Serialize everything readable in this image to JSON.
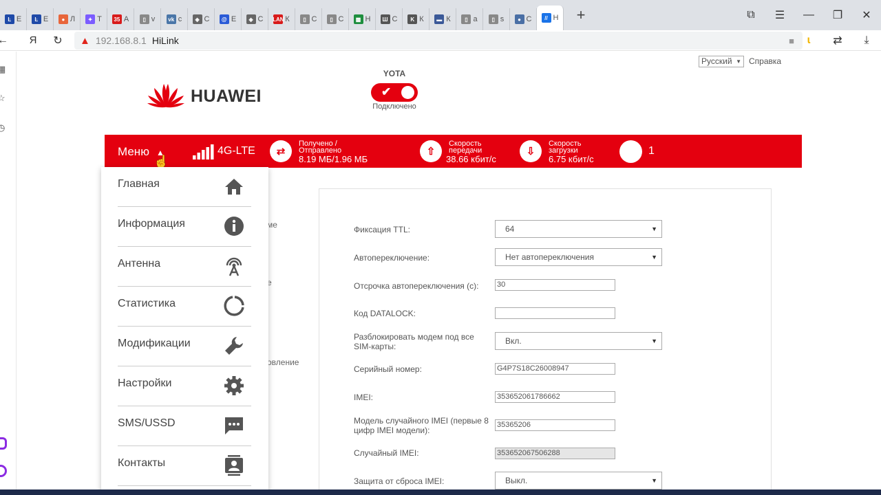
{
  "browser": {
    "tabs": [
      {
        "letter": "Ŀ",
        "color": "#1f4aa8",
        "label": "Е"
      },
      {
        "letter": "Ŀ",
        "color": "#1f4aa8",
        "label": "Е"
      },
      {
        "letter": "●",
        "color": "#e8663b",
        "label": "Л"
      },
      {
        "letter": "✦",
        "color": "#7b5cff",
        "label": "T"
      },
      {
        "letter": "35",
        "color": "#d81b1b",
        "label": "А"
      },
      {
        "letter": "▯",
        "color": "#888888",
        "label": "v"
      },
      {
        "letter": "vk",
        "color": "#4a76a8",
        "label": "c"
      },
      {
        "letter": "◈",
        "color": "#666666",
        "label": "С"
      },
      {
        "letter": "@",
        "color": "#2a5bd7",
        "label": "E"
      },
      {
        "letter": "◈",
        "color": "#666666",
        "label": "С"
      },
      {
        "letter": "LAN",
        "color": "#d81b1b",
        "label": "К"
      },
      {
        "letter": "▯",
        "color": "#888888",
        "label": "С"
      },
      {
        "letter": "▯",
        "color": "#888888",
        "label": "С"
      },
      {
        "letter": "▩",
        "color": "#1e8e3e",
        "label": "Н"
      },
      {
        "letter": "Ш",
        "color": "#555555",
        "label": "С"
      },
      {
        "letter": "K",
        "color": "#555555",
        "label": "К"
      },
      {
        "letter": "▬",
        "color": "#3b5998",
        "label": "К"
      },
      {
        "letter": "▯",
        "color": "#888888",
        "label": "а"
      },
      {
        "letter": "▯",
        "color": "#888888",
        "label": "s"
      },
      {
        "letter": "●",
        "color": "#4a6fa5",
        "label": "С"
      },
      {
        "letter": "//",
        "color": "#1a73e8",
        "label": "Н"
      }
    ],
    "url_host": "192.168.8.1",
    "page_title": "HiLink",
    "yandex_letter": "Я"
  },
  "header": {
    "language": "Русский",
    "help": "Справка",
    "brand": "HUAWEI",
    "provider": "YOTA",
    "connection_status": "Подключено"
  },
  "statusbar": {
    "menu_label": "Меню",
    "network_type": "4G-LTE",
    "traffic_label_1": "Получено /",
    "traffic_label_2": "Отправлено",
    "traffic_value": "8.19 МБ/1.96 МБ",
    "upload_label_1": "Скорость",
    "upload_label_2": "передачи",
    "upload_value": "38.66 кбит/с",
    "download_label_1": "Скорость",
    "download_label_2": "загрузки",
    "download_value": "6.75 кбит/с",
    "notification_count": "1",
    "signal_bars_active": 5,
    "accent_color": "#e4000f"
  },
  "menu": {
    "items": [
      {
        "label": "Главная",
        "icon": "home-icon"
      },
      {
        "label": "Информация",
        "icon": "info-icon"
      },
      {
        "label": "Антенна",
        "icon": "antenna-icon"
      },
      {
        "label": "Статистика",
        "icon": "statistics-icon"
      },
      {
        "label": "Модификации",
        "icon": "wrench-icon"
      },
      {
        "label": "Настройки",
        "icon": "gear-icon"
      },
      {
        "label": "SMS/USSD",
        "icon": "sms-icon"
      },
      {
        "label": "Контакты",
        "icon": "contacts-icon"
      }
    ]
  },
  "background_text": {
    "t1": "ме",
    "t2": "е",
    "t3": "овление"
  },
  "settings": {
    "ttl_label": "Фиксация TTL:",
    "ttl_value": "64",
    "autoswitch_label": "Автопереключение:",
    "autoswitch_value": "Нет автопереключения",
    "delay_label": "Отсрочка автопереключения (с):",
    "delay_value": "30",
    "datalock_label": "Код DATALOCK:",
    "datalock_value": "",
    "unlock_label": "Разблокировать модем под все SIM-карты:",
    "unlock_value": "Вкл.",
    "serial_label": "Серийный номер:",
    "serial_value": "G4P7S18C26008947",
    "imei_label": "IMEI:",
    "imei_value": "353652061786662",
    "random_model_label": "Модель случайного IMEI (первые 8 цифр IMEI модели):",
    "random_model_value": "35365206",
    "random_imei_label": "Случайный IMEI:",
    "random_imei_value": "353652067506288",
    "imei_protect_label": "Защита от сброса IMEI:",
    "imei_protect_value": "Выкл."
  }
}
